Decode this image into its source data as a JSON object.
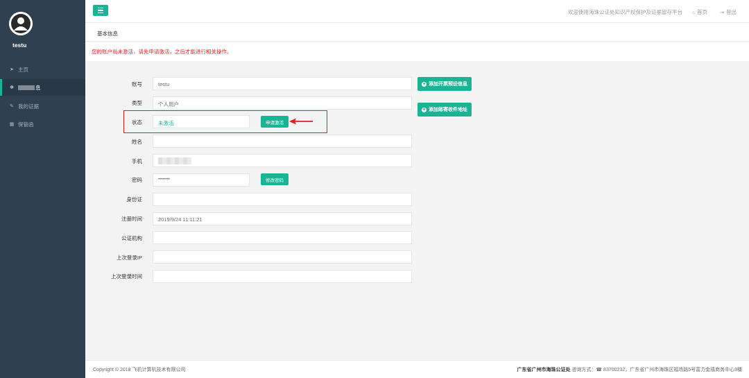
{
  "sidebar": {
    "username": "testu",
    "items": [
      {
        "icon": "paper-plane-icon",
        "glyph": "➤",
        "label": "主页"
      },
      {
        "icon": "gear-icon",
        "glyph": "✲",
        "label": "息"
      },
      {
        "icon": "wrench-icon",
        "glyph": "✎",
        "label": "我的证据"
      },
      {
        "icon": "table-icon",
        "glyph": "▦",
        "label": "保管函"
      }
    ]
  },
  "header": {
    "welcome": "欢迎使用海珠公证处知识产权保护及证据留存平台",
    "home_label": "首页",
    "logout_label": "登出"
  },
  "breadcrumb": "基本信息",
  "alert": "您的账户尚未激活，请先申请激活，之后才能进行相关操作。",
  "form": {
    "account_label": "账号",
    "account_value": "testu",
    "type_label": "类型",
    "type_value": "个人用户",
    "status_label": "状态",
    "status_value": "未激活",
    "apply_activation": "申请激活",
    "name_label": "姓名",
    "name_value": "",
    "phone_label": "手机",
    "password_label": "密码",
    "password_value": "••••••••",
    "change_password": "修改密码",
    "idcard_label": "身份证",
    "idcard_value": "",
    "register_label": "注册时间",
    "register_value": "2019/9/24 11:11:21",
    "notary_label": "公证机构",
    "notary_value": "",
    "last_ip_label": "上次登录IP",
    "last_ip_value": "",
    "last_time_label": "上次登录时间",
    "last_time_value": ""
  },
  "side_buttons": {
    "invoice": "添加开票预设信息",
    "mail": "添加邮寄收件地址"
  },
  "footer": {
    "copyright": "Copyright © 2018 飞机计算机技术有限公司",
    "org": "广东省广州市海珠公证处",
    "contact_rest": " 咨询方式：☎ 83700232，广东省广州市海珠区福场路5号富力金禧商务中心9楼"
  },
  "colors": {
    "accent": "#1ab394",
    "sidebar": "#2f4050",
    "alert": "#ed1c24",
    "highlight": "#e02020"
  }
}
